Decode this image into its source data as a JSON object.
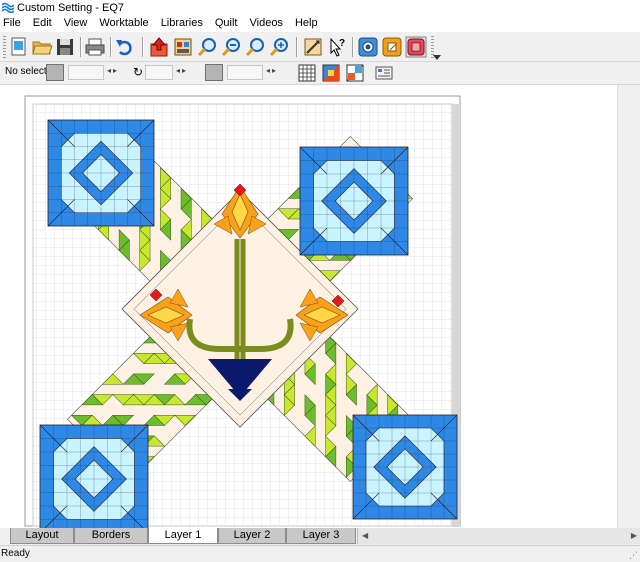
{
  "window": {
    "title": "Custom Setting - EQ7"
  },
  "menu": [
    "File",
    "Edit",
    "View",
    "Worktable",
    "Libraries",
    "Quilt",
    "Videos",
    "Help"
  ],
  "toolbar": {
    "buttons": [
      "new-quilt",
      "open",
      "save",
      "print",
      "undo",
      "add-to-project",
      "view-sketchbook",
      "zoom-in",
      "zoom-out",
      "refresh",
      "fit-to-worktable",
      "adjust",
      "help-pointer",
      "camera",
      "edit-block",
      "edit-fabric"
    ]
  },
  "properties_bar": {
    "selection_label": "No select",
    "colors": {
      "disabled_swatch": "#b4b4b4"
    }
  },
  "quilt": {
    "colors": {
      "blue": "#2e88e6",
      "light_blue": "#c8f3ff",
      "lime": "#c8e830",
      "green": "#6cbc2e",
      "cream": "#fdf1e4",
      "navy": "#0c1a6e",
      "orange": "#f7a21a",
      "yellow": "#ffd84a",
      "red": "#e8191a",
      "stem": "#7a8c1c",
      "grid": "#dcdcdc"
    }
  },
  "tabs": [
    {
      "label": "Layout",
      "active": false
    },
    {
      "label": "Borders",
      "active": false
    },
    {
      "label": "Layer 1",
      "active": true
    },
    {
      "label": "Layer 2",
      "active": false
    },
    {
      "label": "Layer 3",
      "active": false
    }
  ],
  "status": {
    "text": "Ready"
  }
}
